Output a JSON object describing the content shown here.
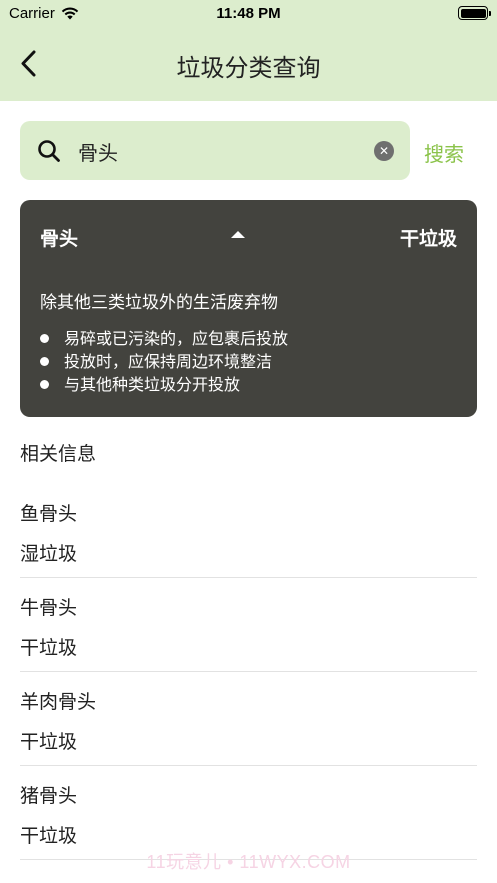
{
  "status_bar": {
    "carrier": "Carrier",
    "time": "11:48 PM"
  },
  "nav": {
    "title": "垃圾分类查询"
  },
  "search": {
    "value": "骨头",
    "button_label": "搜索"
  },
  "result_card": {
    "item_name": "骨头",
    "category": "干垃圾",
    "description": "除其他三类垃圾外的生活废弃物",
    "tips": [
      "易碎或已污染的，应包裹后投放",
      "投放时，应保持周边环境整洁",
      "与其他种类垃圾分开投放"
    ]
  },
  "related": {
    "title": "相关信息",
    "items": [
      {
        "name": "鱼骨头",
        "category": "湿垃圾"
      },
      {
        "name": "牛骨头",
        "category": "干垃圾"
      },
      {
        "name": "羊肉骨头",
        "category": "干垃圾"
      },
      {
        "name": "猪骨头",
        "category": "干垃圾"
      }
    ]
  },
  "watermark": "11玩意儿 • 11WYX.COM",
  "colors": {
    "header_bg": "#dcedcd",
    "card_bg": "#43433e",
    "accent": "#8bc34a"
  }
}
